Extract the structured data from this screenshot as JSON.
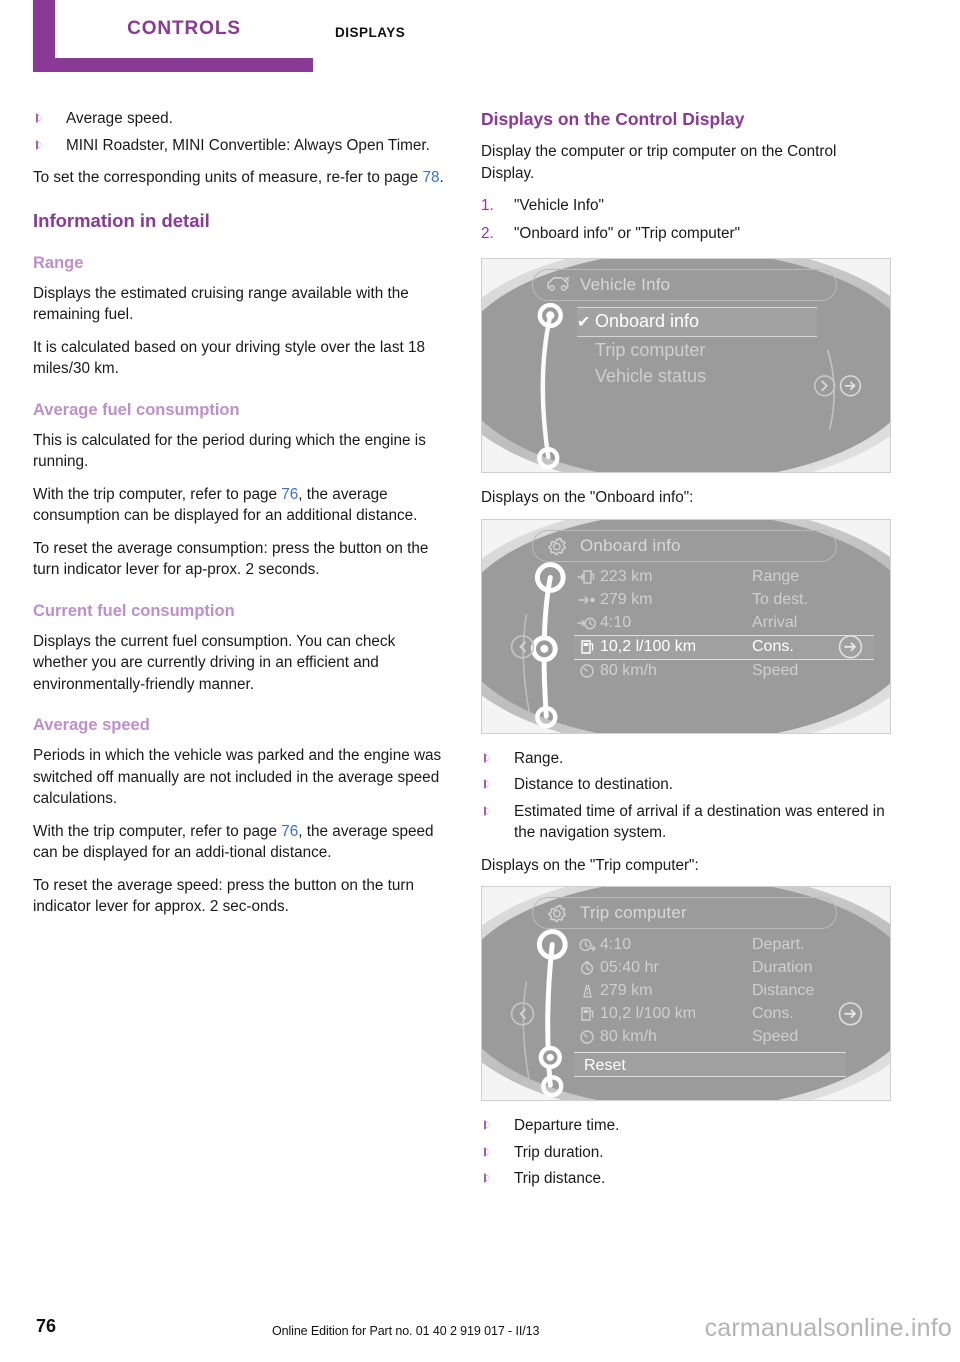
{
  "header": {
    "tab_label": "CONTROLS",
    "secondary_label": "DISPLAYS"
  },
  "left_column": {
    "top_bullets": [
      "Average speed.",
      "MINI Roadster, MINI Convertible: Always Open Timer."
    ],
    "units_note_a": "To set the corresponding units of measure, re-fer to page ",
    "units_note_ref": "78",
    "units_note_b": ".",
    "section_title": "Information in detail",
    "range": {
      "heading": "Range",
      "p1": "Displays the estimated cruising range available with the remaining fuel.",
      "p2": "It is calculated based on your driving style over the last 18 miles/30 km."
    },
    "avg_fuel": {
      "heading": "Average fuel consumption",
      "p1": "This is calculated for the period during which the engine is running.",
      "p2a": "With the trip computer, refer to page ",
      "p2ref": "76",
      "p2b": ", the average consumption can be displayed for an additional distance.",
      "p3": "To reset the average consumption: press the button on the turn indicator lever for ap-prox. 2 seconds."
    },
    "current_fuel": {
      "heading": "Current fuel consumption",
      "p1": "Displays the current fuel consumption. You can check whether you are currently driving in an efficient and environmentally-friendly manner."
    },
    "avg_speed": {
      "heading": "Average speed",
      "p1": "Periods in which the vehicle was parked and the engine was switched off manually are not included in the average speed calculations.",
      "p2a": "With the trip computer, refer to page ",
      "p2ref": "76",
      "p2b": ", the average speed can be displayed for an addi-tional distance.",
      "p3": "To reset the average speed: press the button on the turn indicator lever for approx. 2 sec-onds."
    }
  },
  "right_column": {
    "heading": "Displays on the Control Display",
    "intro": "Display the computer or trip computer on the Control Display.",
    "steps": [
      "\"Vehicle Info\"",
      "\"Onboard info\" or \"Trip computer\""
    ],
    "figure_vehicle_info": {
      "title": "Vehicle Info",
      "title_icon": "car-icon",
      "menu": [
        {
          "label": "Onboard info",
          "selected": true,
          "checked": true
        },
        {
          "label": "Trip computer",
          "selected": false,
          "checked": false
        },
        {
          "label": "Vehicle status",
          "selected": false,
          "checked": false
        }
      ]
    },
    "caption_onboard": "Displays on the \"Onboard info\":",
    "figure_onboard_info": {
      "title": "Onboard info",
      "title_icon": "gear-icon",
      "rows": [
        {
          "icon": "fuel-pump-arrow-icon",
          "value": "223 km",
          "label": "Range",
          "selected": false
        },
        {
          "icon": "arrow-to-dot-icon",
          "value": "279 km",
          "label": "To dest.",
          "selected": false
        },
        {
          "icon": "arrow-clock-icon",
          "value": "4:10",
          "label": "Arrival",
          "selected": false
        },
        {
          "icon": "fuel-pump-icon",
          "value": "10,2 l/100 km",
          "label": "Cons.",
          "selected": true
        },
        {
          "icon": "speedometer-icon",
          "value": "80 km/h",
          "label": "Speed",
          "selected": false
        }
      ]
    },
    "onboard_bullets": [
      "Range.",
      "Distance to destination.",
      "Estimated time of arrival if a destination was entered in the navigation system."
    ],
    "caption_trip": "Displays on the \"Trip computer\":",
    "figure_trip_computer": {
      "title": "Trip computer",
      "title_icon": "gear-icon",
      "rows": [
        {
          "icon": "clock-arrow-icon",
          "value": "4:10",
          "label": "Depart.",
          "selected": false
        },
        {
          "icon": "stopwatch-icon",
          "value": "05:40 hr",
          "label": "Duration",
          "selected": false
        },
        {
          "icon": "road-icon",
          "value": "279  km",
          "label": "Distance",
          "selected": false
        },
        {
          "icon": "fuel-pump-icon",
          "value": "10,2 l/100 km",
          "label": "Cons.",
          "selected": false
        },
        {
          "icon": "speedometer-icon",
          "value": "80 km/h",
          "label": "Speed",
          "selected": false
        }
      ],
      "reset_label": "Reset",
      "reset_selected": true
    },
    "trip_bullets": [
      "Departure time.",
      "Trip duration.",
      "Trip distance."
    ]
  },
  "footer": {
    "page_number": "76",
    "edition": "Online Edition for Part no. 01 40 2 919 017 - II/13",
    "watermark": "carmanualsonline.info"
  },
  "colors": {
    "brand_purple": "#8a3a96",
    "light_purple": "#bd8fcb",
    "page_link_blue": "#3b6fd4",
    "display_gray": "#9b9b9b"
  }
}
